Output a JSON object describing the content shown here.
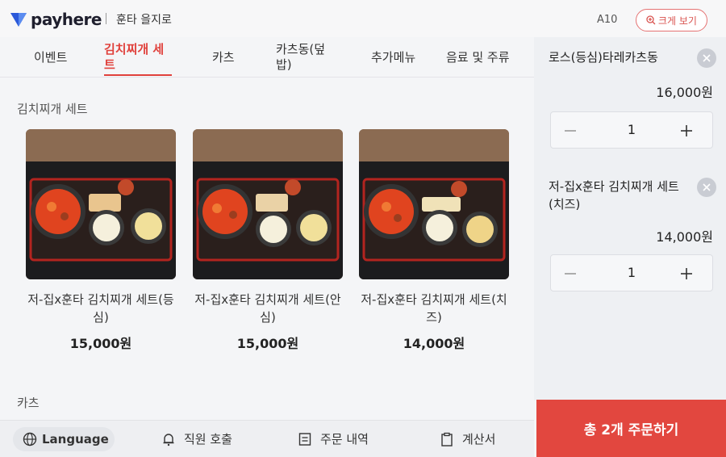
{
  "header": {
    "brand": "payhere",
    "store_name": "훈타 을지로",
    "table_no": "A10",
    "zoom_label": "크게 보기"
  },
  "tabs": [
    {
      "label": "이벤트"
    },
    {
      "label": "김치찌개 세트",
      "active": true
    },
    {
      "label": "카츠"
    },
    {
      "label": "카츠동(덮밥)"
    },
    {
      "label": "추가메뉴"
    },
    {
      "label": "음료 및 주류"
    }
  ],
  "sections": {
    "kimchi_title": "김치찌개 세트",
    "katsu_title": "카츠"
  },
  "menu_items": [
    {
      "name": "저-집x훈타 김치찌개 세트(등심)",
      "price": "15,000원"
    },
    {
      "name": "저-집x훈타 김치찌개 세트(안심)",
      "price": "15,000원"
    },
    {
      "name": "저-집x훈타 김치찌개 세트(치즈)",
      "price": "14,000원"
    }
  ],
  "bottom_bar": {
    "language": "Language",
    "call_staff": "직원 호출",
    "order_history": "주문 내역",
    "bill": "계산서"
  },
  "cart": {
    "items": [
      {
        "name": "로스(등심)타레카츠동",
        "price": "16,000원",
        "qty": "1"
      },
      {
        "name": "저-집x훈타 김치찌개 세트(치즈)",
        "price": "14,000원",
        "qty": "1"
      }
    ],
    "order_button": "총 2개 주문하기"
  },
  "colors": {
    "accent": "#e0413c",
    "order_button": "#e2473f",
    "brand": "#2b59d9"
  }
}
